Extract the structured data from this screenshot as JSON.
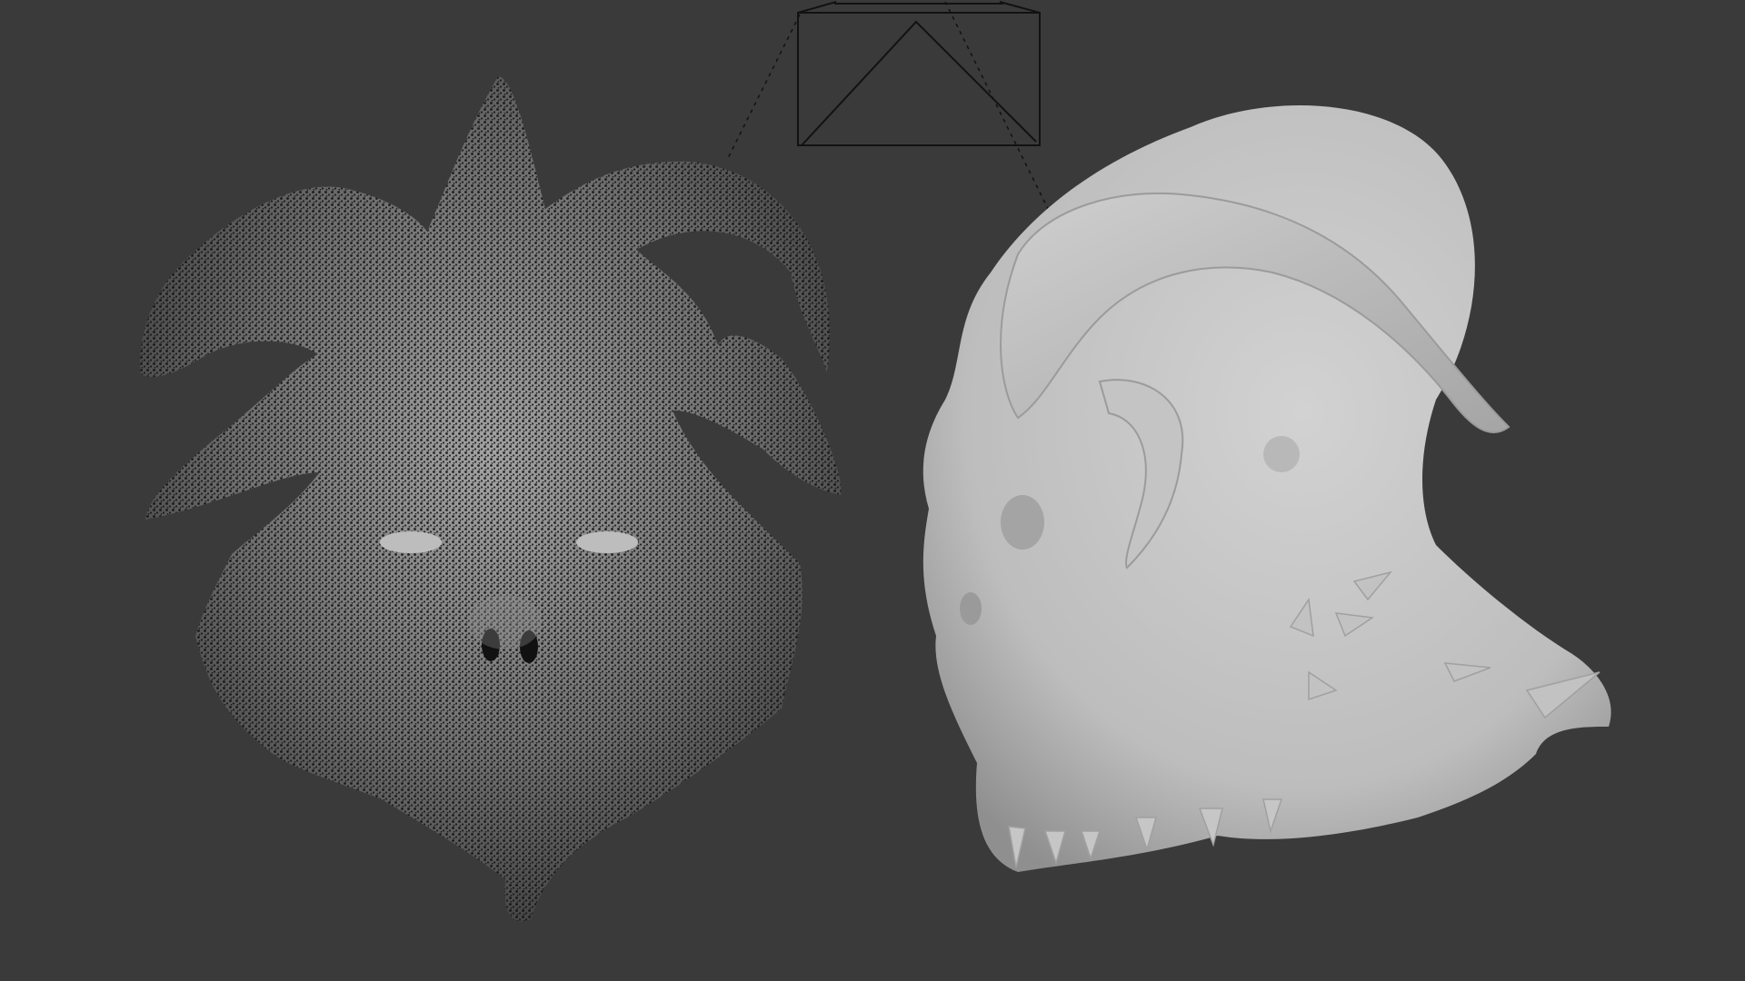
{
  "viewport": {
    "background": "#3a3a3a",
    "objects": [
      {
        "name": "point-cloud-mask",
        "display": "point cloud",
        "point_color": "#0d0d0d",
        "base_color": "#8a8a8a"
      },
      {
        "name": "solid-mesh-head",
        "display": "solid",
        "surface_color": "#c9c9c9",
        "shadow_color": "#9a9a9a"
      },
      {
        "name": "camera",
        "display": "wireframe",
        "line_color": "#111111"
      }
    ]
  }
}
